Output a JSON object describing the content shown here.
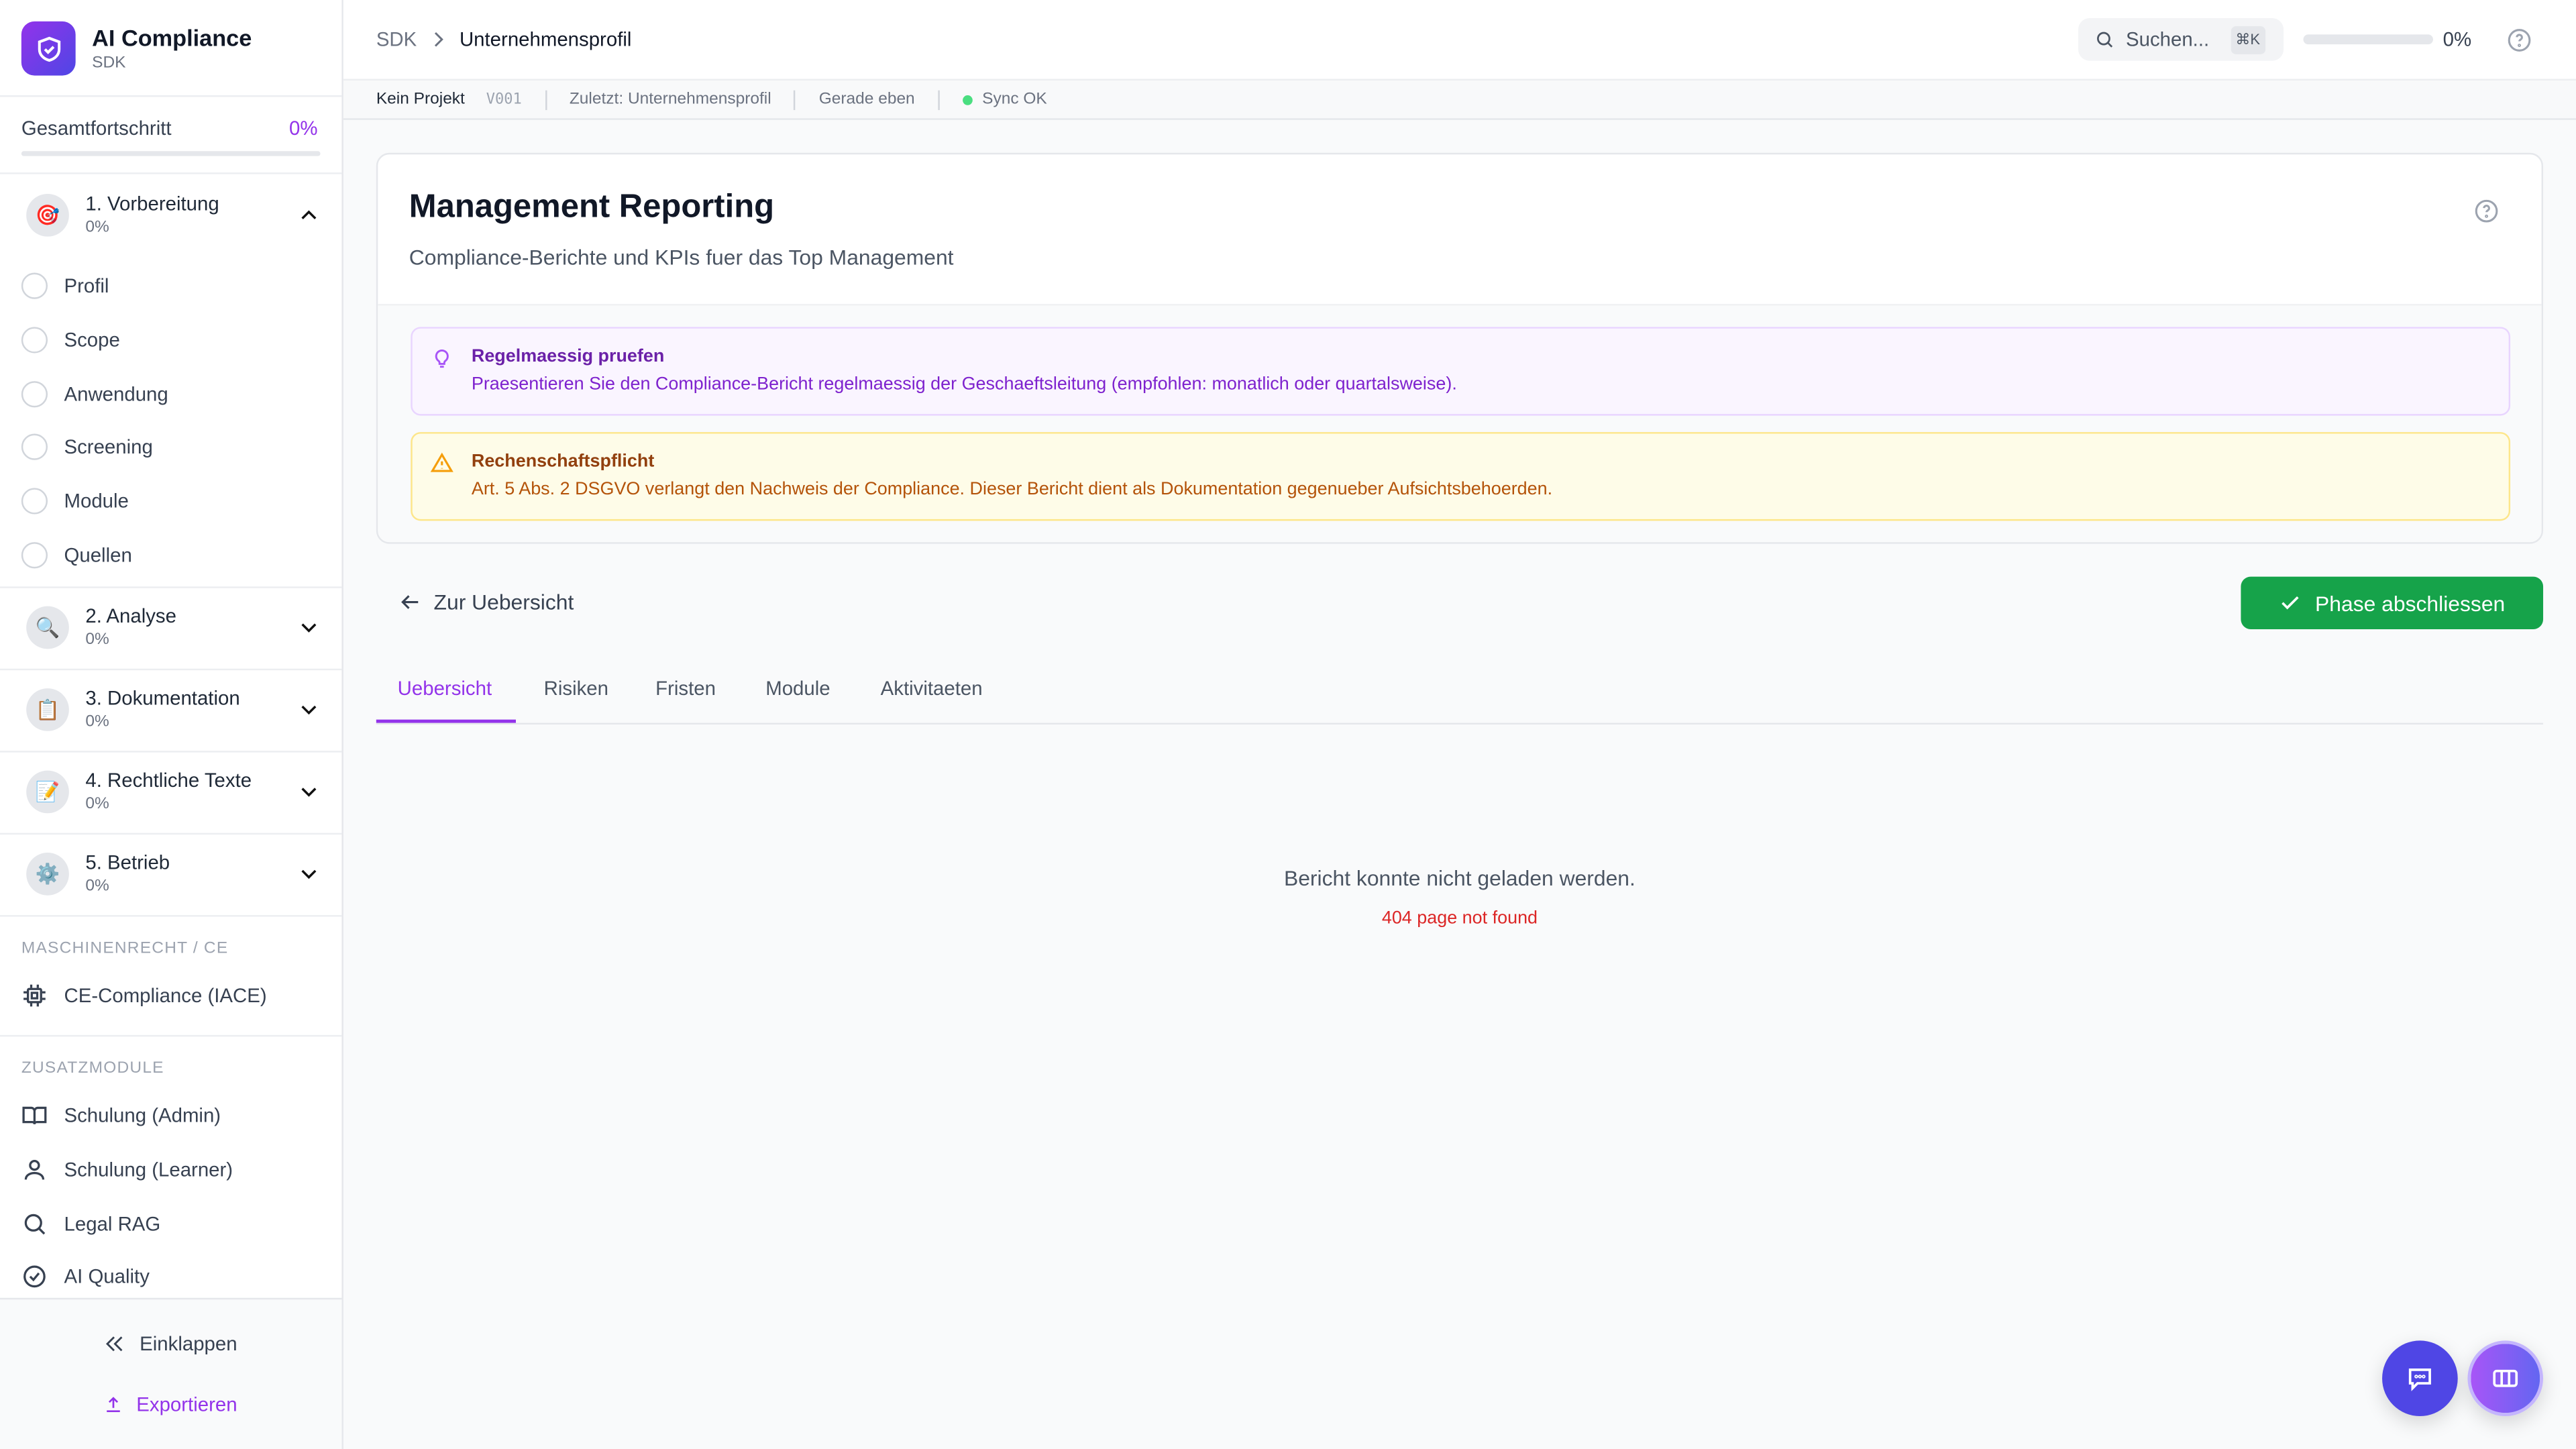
{
  "app": {
    "title": "AI Compliance",
    "subtitle": "SDK"
  },
  "progress": {
    "label": "Gesamtfortschritt",
    "value": "0%",
    "fraction": 0
  },
  "phases": [
    {
      "label": "1. Vorbereitung",
      "progress": "0%",
      "icon": "🎯",
      "expanded": true,
      "items": [
        "Profil",
        "Scope",
        "Anwendung",
        "Screening",
        "Module",
        "Quellen"
      ]
    },
    {
      "label": "2. Analyse",
      "progress": "0%",
      "icon": "🔍"
    },
    {
      "label": "3. Dokumentation",
      "progress": "0%",
      "icon": "📋"
    },
    {
      "label": "4. Rechtliche Texte",
      "progress": "0%",
      "icon": "📝"
    },
    {
      "label": "5. Betrieb",
      "progress": "0%",
      "icon": "⚙️"
    }
  ],
  "sections": {
    "machine": {
      "title": "MASCHINENRECHT / CE",
      "items": [
        "CE-Compliance (IACE)"
      ]
    },
    "extra": {
      "title": "ZUSATZMODULE",
      "items": [
        "Schulung (Admin)",
        "Schulung (Learner)",
        "Legal RAG",
        "AI Quality"
      ]
    }
  },
  "sidebar_footer": {
    "collapse": "Einklappen",
    "export": "Exportieren"
  },
  "header": {
    "breadcrumb": [
      "SDK",
      "Unternehmensprofil"
    ],
    "search_placeholder": "Suchen...",
    "shortcut": "⌘K",
    "progress": "0%"
  },
  "subbar": {
    "project": "Kein Projekt",
    "version": "V001",
    "last": "Zuletzt: Unternehmensprofil",
    "time": "Gerade eben",
    "sync": "Sync OK"
  },
  "page": {
    "title": "Management Reporting",
    "subtitle": "Compliance-Berichte und KPIs fuer das Top Management"
  },
  "alerts": [
    {
      "title": "Regelmaessig pruefen",
      "text": "Praesentieren Sie den Compliance-Bericht regelmaessig der Geschaeftsleitung (empfohlen: monatlich oder quartalsweise).",
      "type": "info"
    },
    {
      "title": "Rechenschaftspflicht",
      "text": "Art. 5 Abs. 2 DSGVO verlangt den Nachweis der Compliance. Dieser Bericht dient als Dokumentation gegenueber Aufsichtsbehoerden.",
      "type": "warning"
    }
  ],
  "actions": {
    "back": "Zur Uebersicht",
    "complete": "Phase abschliessen"
  },
  "tabs": [
    "Uebersicht",
    "Risiken",
    "Fristen",
    "Module",
    "Aktivitaeten"
  ],
  "active_tab": "Uebersicht",
  "error": {
    "message": "Bericht konnte nicht geladen werden.",
    "detail": "404 page not found"
  },
  "colors": {
    "accent": "#9333ea",
    "success": "#16a34a",
    "error": "#dc2626"
  }
}
